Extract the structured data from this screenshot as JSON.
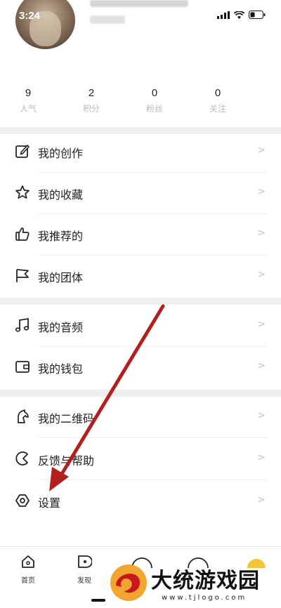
{
  "status_bar": {
    "time": "3:24"
  },
  "profile": {
    "avatar": "avatar"
  },
  "stats": [
    {
      "value": "9",
      "label": "人气"
    },
    {
      "value": "2",
      "label": "积分"
    },
    {
      "value": "0",
      "label": "粉丝"
    },
    {
      "value": "0",
      "label": "关注"
    }
  ],
  "menu_group_1": [
    {
      "label": "我的创作",
      "icon": "edit-icon"
    },
    {
      "label": "我的收藏",
      "icon": "star-icon"
    },
    {
      "label": "我推荐的",
      "icon": "thumbs-up-icon"
    },
    {
      "label": "我的团体",
      "icon": "flag-icon"
    }
  ],
  "menu_group_2": [
    {
      "label": "我的音频",
      "icon": "music-icon"
    },
    {
      "label": "我的钱包",
      "icon": "wallet-icon"
    }
  ],
  "menu_group_3": [
    {
      "label": "我的二维码",
      "icon": "qr-icon"
    },
    {
      "label": "反馈与帮助",
      "icon": "feedback-icon"
    },
    {
      "label": "设置",
      "icon": "settings-icon"
    }
  ],
  "tabbar": {
    "home_label": "首页",
    "discover_label": "发现"
  },
  "watermark": {
    "name": "大统游戏园",
    "url": "www.tjlogo.com"
  },
  "colors": {
    "arrow": "#b11f1f",
    "divider": "#efefef",
    "chevron": "#c2c2c2"
  }
}
